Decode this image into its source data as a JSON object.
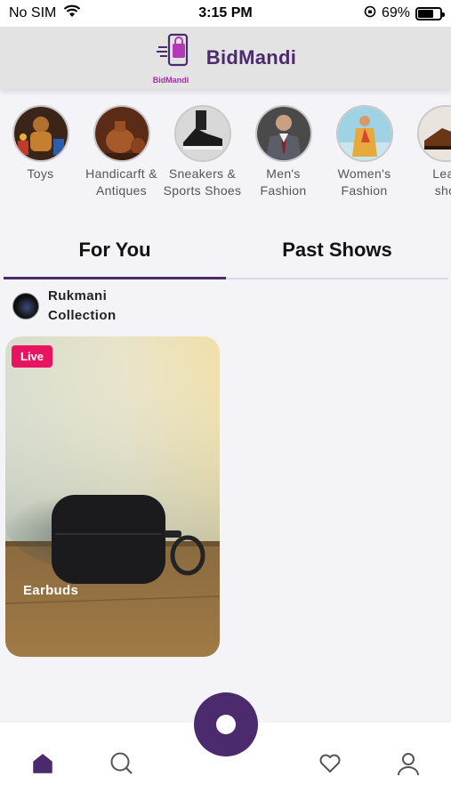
{
  "status_bar": {
    "carrier": "No SIM",
    "time": "3:15 PM",
    "battery": "69%",
    "battery_level": 0.69
  },
  "header": {
    "brand": "BidMandi",
    "logo_caption": "BidMandi"
  },
  "categories": [
    {
      "label": "Toys",
      "icon": "toys-thumbnail"
    },
    {
      "label": "Handicarft &\nAntiques",
      "icon": "handicraft-thumbnail"
    },
    {
      "label": "Sneakers &\nSports Shoes",
      "icon": "sneakers-thumbnail"
    },
    {
      "label": "Men's\nFashion",
      "icon": "mens-fashion-thumbnail"
    },
    {
      "label": "Women's\nFashion",
      "icon": "womens-fashion-thumbnail"
    },
    {
      "label": "Leat\nsho",
      "icon": "leather-shoes-thumbnail"
    }
  ],
  "tabs": [
    {
      "label": "For You",
      "active": true
    },
    {
      "label": "Past Shows",
      "active": false
    }
  ],
  "show": {
    "seller": "Rukmani\nCollection",
    "badge": "Live",
    "title": "Earbuds"
  },
  "nav": {
    "items": [
      "home-icon",
      "search-icon",
      "go-live-button",
      "heart-icon",
      "profile-icon"
    ],
    "accent": "#4b2a6e",
    "live_color": "#e8145f"
  }
}
